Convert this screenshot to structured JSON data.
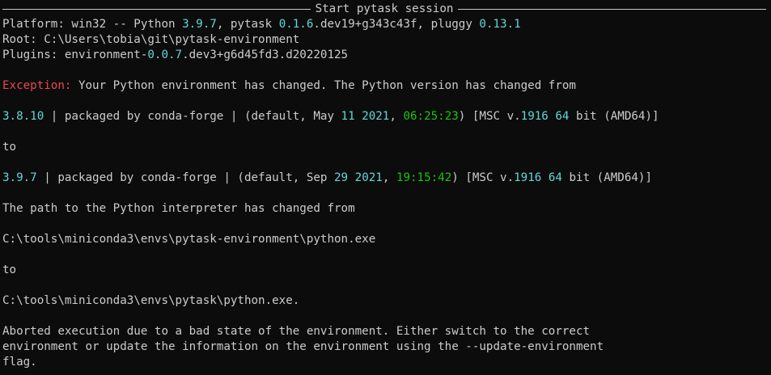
{
  "session": {
    "title": "Start pytask session"
  },
  "header": {
    "platform_prefix": "Platform: win32 -- Python ",
    "python_version": "3.9.7",
    "pytask_prefix": ", pytask ",
    "pytask_version_a": "0.1.6",
    "pytask_version_b": ".dev19+g343c43f",
    "pluggy_prefix": ", pluggy ",
    "pluggy_version": "0.13.1",
    "root": "Root: C:\\Users\\tobia\\git\\pytask-environment",
    "plugins_prefix": "Plugins: environment-",
    "plugins_version": "0.0.7",
    "plugins_suffix": ".dev3+g6d45fd3.d20220125"
  },
  "error": {
    "exception_label": "Exception:",
    "exception_message": " Your Python environment has changed. The Python version has changed from",
    "old_version": {
      "version": "3.8.10",
      "build_text": " | packaged by conda-forge | (default, May ",
      "day": "11",
      "year": "2021",
      "time": "06:25:23",
      "msc_prefix": ") [MSC v.",
      "msc_num": "1916",
      "bits": "64",
      "suffix": " bit (AMD64)]"
    },
    "to_1": "to",
    "new_version": {
      "version": "3.9.7",
      "build_text": " | packaged by conda-forge | (default, Sep ",
      "day": "29",
      "year": "2021",
      "time": "19:15:42",
      "msc_prefix": ") [MSC v.",
      "msc_num": "1916",
      "bits": "64",
      "suffix": " bit (AMD64)]"
    },
    "path_message": "The path to the Python interpreter has changed from",
    "old_path": "C:\\tools\\miniconda3\\envs\\pytask-environment\\python.exe",
    "to_2": "to",
    "new_path": "C:\\tools\\miniconda3\\envs\\pytask\\python.exe.",
    "abort_1": "Aborted execution due to a bad state of the environment. Either switch to the correct",
    "abort_2": "environment or update the information on the environment using the --update-environment",
    "abort_3": "flag."
  },
  "colors": {
    "background": "#0c0c0c",
    "foreground": "#cccccc",
    "number": "#3a96dd",
    "number_teal": "#61d6d6",
    "time": "#16c60c",
    "exception": "#e74856"
  }
}
